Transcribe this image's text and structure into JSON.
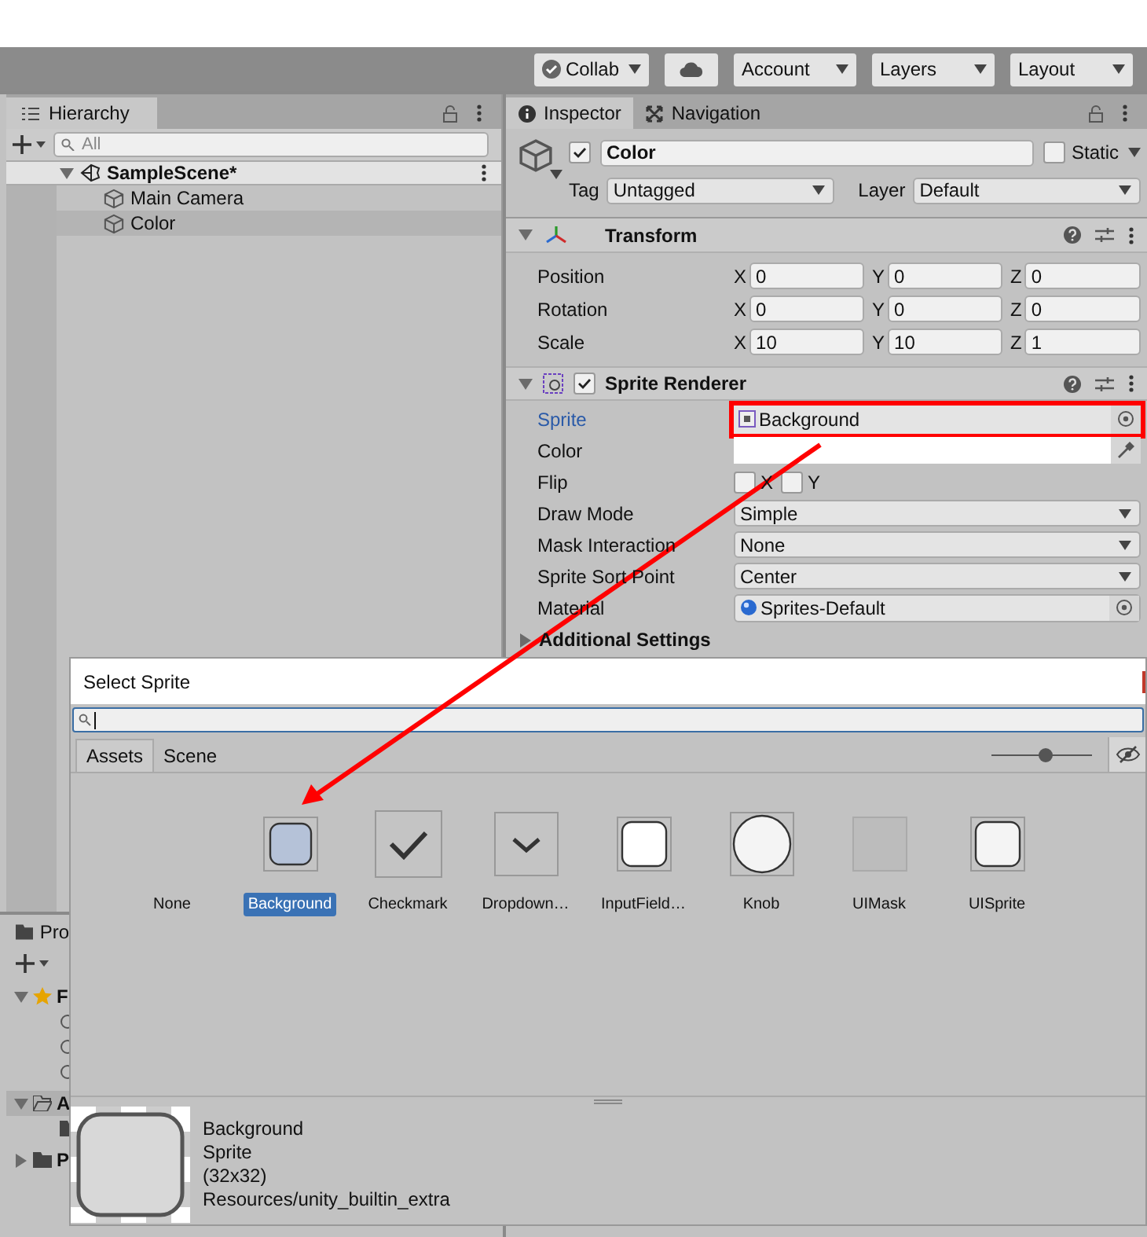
{
  "toolbar": {
    "buttons": [
      {
        "kind": "collab",
        "label": "Collab"
      },
      {
        "kind": "cloud"
      },
      {
        "kind": "menu",
        "label": "Account"
      },
      {
        "kind": "menu",
        "label": "Layers"
      },
      {
        "kind": "menu",
        "label": "Layout"
      }
    ]
  },
  "hierarchy": {
    "tab": "Hierarchy",
    "search": {
      "placeholder": "All"
    },
    "scene": "SampleScene*",
    "items": [
      {
        "label": "Main Camera",
        "selected": false
      },
      {
        "label": "Color",
        "selected": true
      }
    ]
  },
  "project": {
    "tab": "Pro",
    "sections": [
      {
        "label": "F",
        "kind": "favorites",
        "expanded": true
      },
      {
        "label": "A",
        "kind": "assets",
        "expanded": true
      },
      {
        "label": "P",
        "kind": "packages",
        "expanded": false
      }
    ]
  },
  "inspector": {
    "tabs": [
      {
        "label": "Inspector",
        "kind": "info",
        "selected": true
      },
      {
        "label": "Navigation",
        "kind": "nav",
        "selected": false
      }
    ],
    "object": {
      "active": true,
      "name": "Color",
      "static": false,
      "static_label": "Static",
      "tag_label": "Tag",
      "tag": "Untagged",
      "layer_label": "Layer",
      "layer": "Default"
    },
    "transform": {
      "title": "Transform",
      "expanded": true,
      "rows": [
        {
          "label": "Position",
          "fields": [
            {
              "axis": "X",
              "value": "0"
            },
            {
              "axis": "Y",
              "value": "0"
            },
            {
              "axis": "Z",
              "value": "0"
            }
          ]
        },
        {
          "label": "Rotation",
          "fields": [
            {
              "axis": "X",
              "value": "0"
            },
            {
              "axis": "Y",
              "value": "0"
            },
            {
              "axis": "Z",
              "value": "0"
            }
          ]
        },
        {
          "label": "Scale",
          "fields": [
            {
              "axis": "X",
              "value": "10"
            },
            {
              "axis": "Y",
              "value": "10"
            },
            {
              "axis": "Z",
              "value": "1"
            }
          ]
        }
      ]
    },
    "sprite_renderer": {
      "title": "Sprite Renderer",
      "enabled": true,
      "expanded": true,
      "rows": [
        {
          "kind": "object",
          "label": "Sprite",
          "value": "Background",
          "focused": true,
          "highlighted": true
        },
        {
          "kind": "color",
          "label": "Color"
        },
        {
          "kind": "flip",
          "label": "Flip",
          "options": [
            {
              "label": "X",
              "checked": false
            },
            {
              "label": "Y",
              "checked": false
            }
          ]
        },
        {
          "kind": "dropdown",
          "label": "Draw Mode",
          "value": "Simple"
        },
        {
          "kind": "dropdown",
          "label": "Mask Interaction",
          "value": "None"
        },
        {
          "kind": "dropdown",
          "label": "Sprite Sort Point",
          "value": "Center"
        },
        {
          "kind": "material",
          "label": "Material",
          "value": "Sprites-Default",
          "focused": false,
          "highlighted": false
        }
      ]
    },
    "additional": {
      "label": "Additional Settings",
      "expanded": false
    }
  },
  "dialog": {
    "title": "Select Sprite",
    "tabs": [
      {
        "label": "Assets",
        "selected": true
      },
      {
        "label": "Scene",
        "selected": false
      }
    ],
    "zoom": {
      "level": 0.53
    },
    "items": [
      {
        "label": "None",
        "kind": "none",
        "selected": false
      },
      {
        "label": "Background",
        "kind": "tinted",
        "selected": true
      },
      {
        "label": "Checkmark",
        "kind": "check",
        "selected": false
      },
      {
        "label": "Dropdown…",
        "kind": "chevron",
        "selected": false
      },
      {
        "label": "InputField…",
        "kind": "rounded",
        "selected": false
      },
      {
        "label": "Knob",
        "kind": "circle",
        "selected": false
      },
      {
        "label": "UIMask",
        "kind": "mask",
        "selected": false
      },
      {
        "label": "UISprite",
        "kind": "soft",
        "selected": false
      }
    ],
    "preview": {
      "lines": [
        "Background",
        "Sprite",
        "(32x32)",
        "Resources/unity_builtin_extra"
      ]
    }
  }
}
